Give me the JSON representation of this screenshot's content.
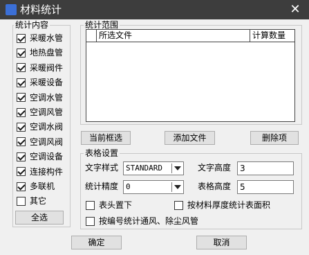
{
  "window": {
    "title": "材料统计",
    "app_icon": "ACAD",
    "close_label": "✕"
  },
  "content_group": {
    "title": "统计内容",
    "items": [
      {
        "label": "采暖水管",
        "checked": true
      },
      {
        "label": "地热盘管",
        "checked": true
      },
      {
        "label": "采暖阀件",
        "checked": true
      },
      {
        "label": "采暖设备",
        "checked": true
      },
      {
        "label": "空调水管",
        "checked": true
      },
      {
        "label": "空调风管",
        "checked": true
      },
      {
        "label": "空调水阀",
        "checked": true
      },
      {
        "label": "空调风阀",
        "checked": true
      },
      {
        "label": "空调设备",
        "checked": true
      },
      {
        "label": "连接构件",
        "checked": true
      },
      {
        "label": "多联机",
        "checked": true
      },
      {
        "label": "其它",
        "checked": false
      }
    ],
    "select_all_label": "全选"
  },
  "range_group": {
    "title": "统计范围",
    "columns": [
      "所选文件",
      "计算数量"
    ],
    "buttons": {
      "current_select": "当前框选",
      "add_file": "添加文件",
      "delete_item": "删除项"
    }
  },
  "table_settings": {
    "title": "表格设置",
    "text_style": {
      "label": "文字样式",
      "value": "STANDARD"
    },
    "text_height": {
      "label": "文字高度",
      "value": "3"
    },
    "precision": {
      "label": "统计精度",
      "value": "0"
    },
    "table_height": {
      "label": "表格高度",
      "value": "5"
    },
    "header_bottom": {
      "label": "表头置下",
      "checked": false
    },
    "by_thickness": {
      "label": "按材料厚度统计表面积",
      "checked": false
    },
    "by_number": {
      "label": "按编号统计通风、除尘风管",
      "checked": false
    }
  },
  "footer": {
    "ok_label": "确定",
    "cancel_label": "取消"
  }
}
